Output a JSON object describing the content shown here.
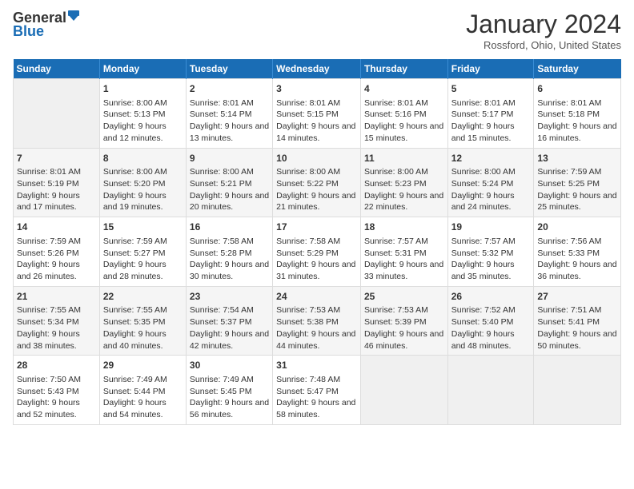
{
  "header": {
    "logo_general": "General",
    "logo_blue": "Blue",
    "title": "January 2024",
    "location": "Rossford, Ohio, United States"
  },
  "days_of_week": [
    "Sunday",
    "Monday",
    "Tuesday",
    "Wednesday",
    "Thursday",
    "Friday",
    "Saturday"
  ],
  "weeks": [
    [
      {
        "day": "",
        "empty": true
      },
      {
        "day": "1",
        "sunrise": "Sunrise: 8:00 AM",
        "sunset": "Sunset: 5:13 PM",
        "daylight": "Daylight: 9 hours and 12 minutes."
      },
      {
        "day": "2",
        "sunrise": "Sunrise: 8:01 AM",
        "sunset": "Sunset: 5:14 PM",
        "daylight": "Daylight: 9 hours and 13 minutes."
      },
      {
        "day": "3",
        "sunrise": "Sunrise: 8:01 AM",
        "sunset": "Sunset: 5:15 PM",
        "daylight": "Daylight: 9 hours and 14 minutes."
      },
      {
        "day": "4",
        "sunrise": "Sunrise: 8:01 AM",
        "sunset": "Sunset: 5:16 PM",
        "daylight": "Daylight: 9 hours and 15 minutes."
      },
      {
        "day": "5",
        "sunrise": "Sunrise: 8:01 AM",
        "sunset": "Sunset: 5:17 PM",
        "daylight": "Daylight: 9 hours and 15 minutes."
      },
      {
        "day": "6",
        "sunrise": "Sunrise: 8:01 AM",
        "sunset": "Sunset: 5:18 PM",
        "daylight": "Daylight: 9 hours and 16 minutes."
      }
    ],
    [
      {
        "day": "7",
        "sunrise": "Sunrise: 8:01 AM",
        "sunset": "Sunset: 5:19 PM",
        "daylight": "Daylight: 9 hours and 17 minutes."
      },
      {
        "day": "8",
        "sunrise": "Sunrise: 8:00 AM",
        "sunset": "Sunset: 5:20 PM",
        "daylight": "Daylight: 9 hours and 19 minutes."
      },
      {
        "day": "9",
        "sunrise": "Sunrise: 8:00 AM",
        "sunset": "Sunset: 5:21 PM",
        "daylight": "Daylight: 9 hours and 20 minutes."
      },
      {
        "day": "10",
        "sunrise": "Sunrise: 8:00 AM",
        "sunset": "Sunset: 5:22 PM",
        "daylight": "Daylight: 9 hours and 21 minutes."
      },
      {
        "day": "11",
        "sunrise": "Sunrise: 8:00 AM",
        "sunset": "Sunset: 5:23 PM",
        "daylight": "Daylight: 9 hours and 22 minutes."
      },
      {
        "day": "12",
        "sunrise": "Sunrise: 8:00 AM",
        "sunset": "Sunset: 5:24 PM",
        "daylight": "Daylight: 9 hours and 24 minutes."
      },
      {
        "day": "13",
        "sunrise": "Sunrise: 7:59 AM",
        "sunset": "Sunset: 5:25 PM",
        "daylight": "Daylight: 9 hours and 25 minutes."
      }
    ],
    [
      {
        "day": "14",
        "sunrise": "Sunrise: 7:59 AM",
        "sunset": "Sunset: 5:26 PM",
        "daylight": "Daylight: 9 hours and 26 minutes."
      },
      {
        "day": "15",
        "sunrise": "Sunrise: 7:59 AM",
        "sunset": "Sunset: 5:27 PM",
        "daylight": "Daylight: 9 hours and 28 minutes."
      },
      {
        "day": "16",
        "sunrise": "Sunrise: 7:58 AM",
        "sunset": "Sunset: 5:28 PM",
        "daylight": "Daylight: 9 hours and 30 minutes."
      },
      {
        "day": "17",
        "sunrise": "Sunrise: 7:58 AM",
        "sunset": "Sunset: 5:29 PM",
        "daylight": "Daylight: 9 hours and 31 minutes."
      },
      {
        "day": "18",
        "sunrise": "Sunrise: 7:57 AM",
        "sunset": "Sunset: 5:31 PM",
        "daylight": "Daylight: 9 hours and 33 minutes."
      },
      {
        "day": "19",
        "sunrise": "Sunrise: 7:57 AM",
        "sunset": "Sunset: 5:32 PM",
        "daylight": "Daylight: 9 hours and 35 minutes."
      },
      {
        "day": "20",
        "sunrise": "Sunrise: 7:56 AM",
        "sunset": "Sunset: 5:33 PM",
        "daylight": "Daylight: 9 hours and 36 minutes."
      }
    ],
    [
      {
        "day": "21",
        "sunrise": "Sunrise: 7:55 AM",
        "sunset": "Sunset: 5:34 PM",
        "daylight": "Daylight: 9 hours and 38 minutes."
      },
      {
        "day": "22",
        "sunrise": "Sunrise: 7:55 AM",
        "sunset": "Sunset: 5:35 PM",
        "daylight": "Daylight: 9 hours and 40 minutes."
      },
      {
        "day": "23",
        "sunrise": "Sunrise: 7:54 AM",
        "sunset": "Sunset: 5:37 PM",
        "daylight": "Daylight: 9 hours and 42 minutes."
      },
      {
        "day": "24",
        "sunrise": "Sunrise: 7:53 AM",
        "sunset": "Sunset: 5:38 PM",
        "daylight": "Daylight: 9 hours and 44 minutes."
      },
      {
        "day": "25",
        "sunrise": "Sunrise: 7:53 AM",
        "sunset": "Sunset: 5:39 PM",
        "daylight": "Daylight: 9 hours and 46 minutes."
      },
      {
        "day": "26",
        "sunrise": "Sunrise: 7:52 AM",
        "sunset": "Sunset: 5:40 PM",
        "daylight": "Daylight: 9 hours and 48 minutes."
      },
      {
        "day": "27",
        "sunrise": "Sunrise: 7:51 AM",
        "sunset": "Sunset: 5:41 PM",
        "daylight": "Daylight: 9 hours and 50 minutes."
      }
    ],
    [
      {
        "day": "28",
        "sunrise": "Sunrise: 7:50 AM",
        "sunset": "Sunset: 5:43 PM",
        "daylight": "Daylight: 9 hours and 52 minutes."
      },
      {
        "day": "29",
        "sunrise": "Sunrise: 7:49 AM",
        "sunset": "Sunset: 5:44 PM",
        "daylight": "Daylight: 9 hours and 54 minutes."
      },
      {
        "day": "30",
        "sunrise": "Sunrise: 7:49 AM",
        "sunset": "Sunset: 5:45 PM",
        "daylight": "Daylight: 9 hours and 56 minutes."
      },
      {
        "day": "31",
        "sunrise": "Sunrise: 7:48 AM",
        "sunset": "Sunset: 5:47 PM",
        "daylight": "Daylight: 9 hours and 58 minutes."
      },
      {
        "day": "",
        "empty": true
      },
      {
        "day": "",
        "empty": true
      },
      {
        "day": "",
        "empty": true
      }
    ]
  ]
}
